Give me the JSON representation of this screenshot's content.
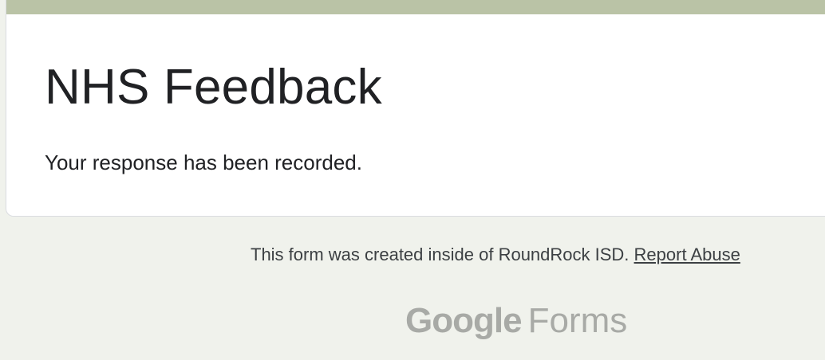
{
  "form": {
    "title": "NHS Feedback",
    "confirmation_message": "Your response has been recorded."
  },
  "footer": {
    "created_inside_text": "This form was created inside of RoundRock ISD.",
    "report_abuse_label": "Report Abuse"
  },
  "branding": {
    "google_text": "Google",
    "forms_text": "Forms"
  },
  "colors": {
    "accent_bar": "#bac3a6",
    "page_background": "#f0f2ec",
    "card_background": "#ffffff",
    "brand_gray": "#a8aaa6"
  }
}
